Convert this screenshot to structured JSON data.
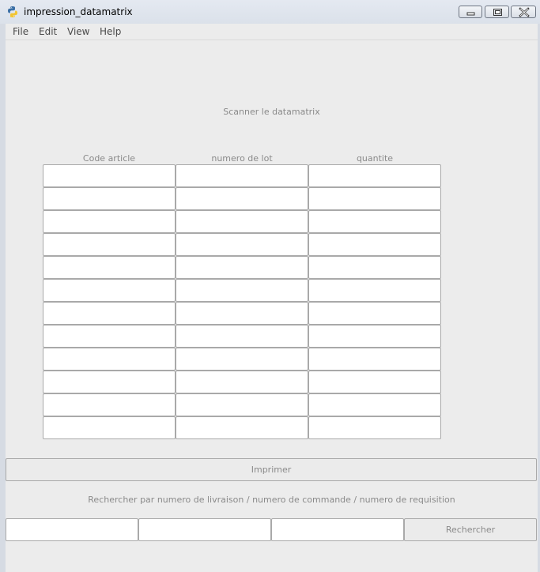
{
  "window": {
    "title": "impression_datamatrix",
    "icon": "python-icon",
    "controls": {
      "minimize": "minimize-icon",
      "maximize": "maximize-icon",
      "close": "close-icon"
    }
  },
  "menu": [
    "File",
    "Edit",
    "View",
    "Help"
  ],
  "scan_label": "Scanner le datamatrix",
  "table": {
    "columns": [
      "Code article",
      "numero de lot",
      "quantite"
    ],
    "row_count": 12
  },
  "print_button": "Imprimer",
  "search": {
    "label": "Rechercher par numero de livraison / numero de commande / numero de requisition",
    "fields": [
      "",
      "",
      ""
    ],
    "button": "Rechercher"
  },
  "colors": {
    "titlebar": "#dbe1ea",
    "client_bg": "#ececec",
    "border": "#a9a9a9",
    "label_text": "#8a8a8a"
  }
}
